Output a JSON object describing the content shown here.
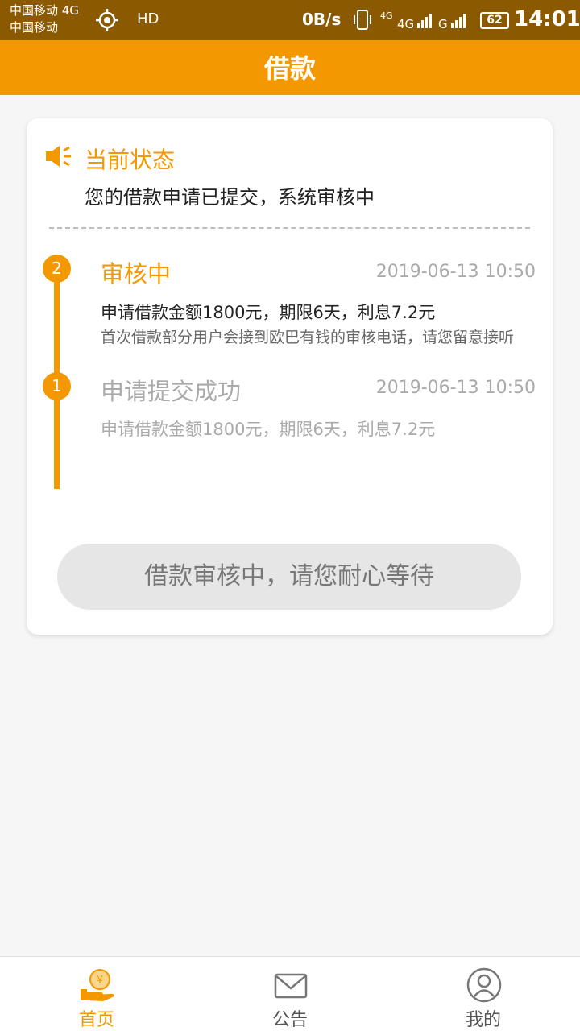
{
  "status_bar": {
    "carrier_line1": "中国移动 4G",
    "carrier_line2": "中国移动",
    "hd": "HD",
    "network_speed": "0B/s",
    "signal_label_4g": "4G",
    "signal_label_g": "G",
    "battery": "62",
    "time": "14:01"
  },
  "header": {
    "title": "借款"
  },
  "status_section": {
    "title": "当前状态",
    "message": "您的借款申请已提交，系统审核中"
  },
  "timeline": {
    "steps": [
      {
        "number": "2",
        "title": "审核中",
        "time": "2019-06-13 10:50",
        "description": "申请借款金额1800元，期限6天，利息7.2元",
        "note": "首次借款部分用户会接到欧巴有钱的审核电话，请您留意接听"
      },
      {
        "number": "1",
        "title": "申请提交成功",
        "time": "2019-06-13 10:50",
        "description": "申请借款金额1800元，期限6天，利息7.2元"
      }
    ]
  },
  "action_button": {
    "label": "借款审核中，请您耐心等待"
  },
  "bottom_nav": {
    "items": [
      {
        "label": "首页",
        "icon": "coin-hand-icon",
        "active": true
      },
      {
        "label": "公告",
        "icon": "envelope-icon",
        "active": false
      },
      {
        "label": "我的",
        "icon": "user-icon",
        "active": false
      }
    ]
  },
  "colors": {
    "accent": "#f39800",
    "status_bar": "#8b5a00",
    "muted_text": "#aaaaaa",
    "button_bg": "#e6e6e6"
  }
}
